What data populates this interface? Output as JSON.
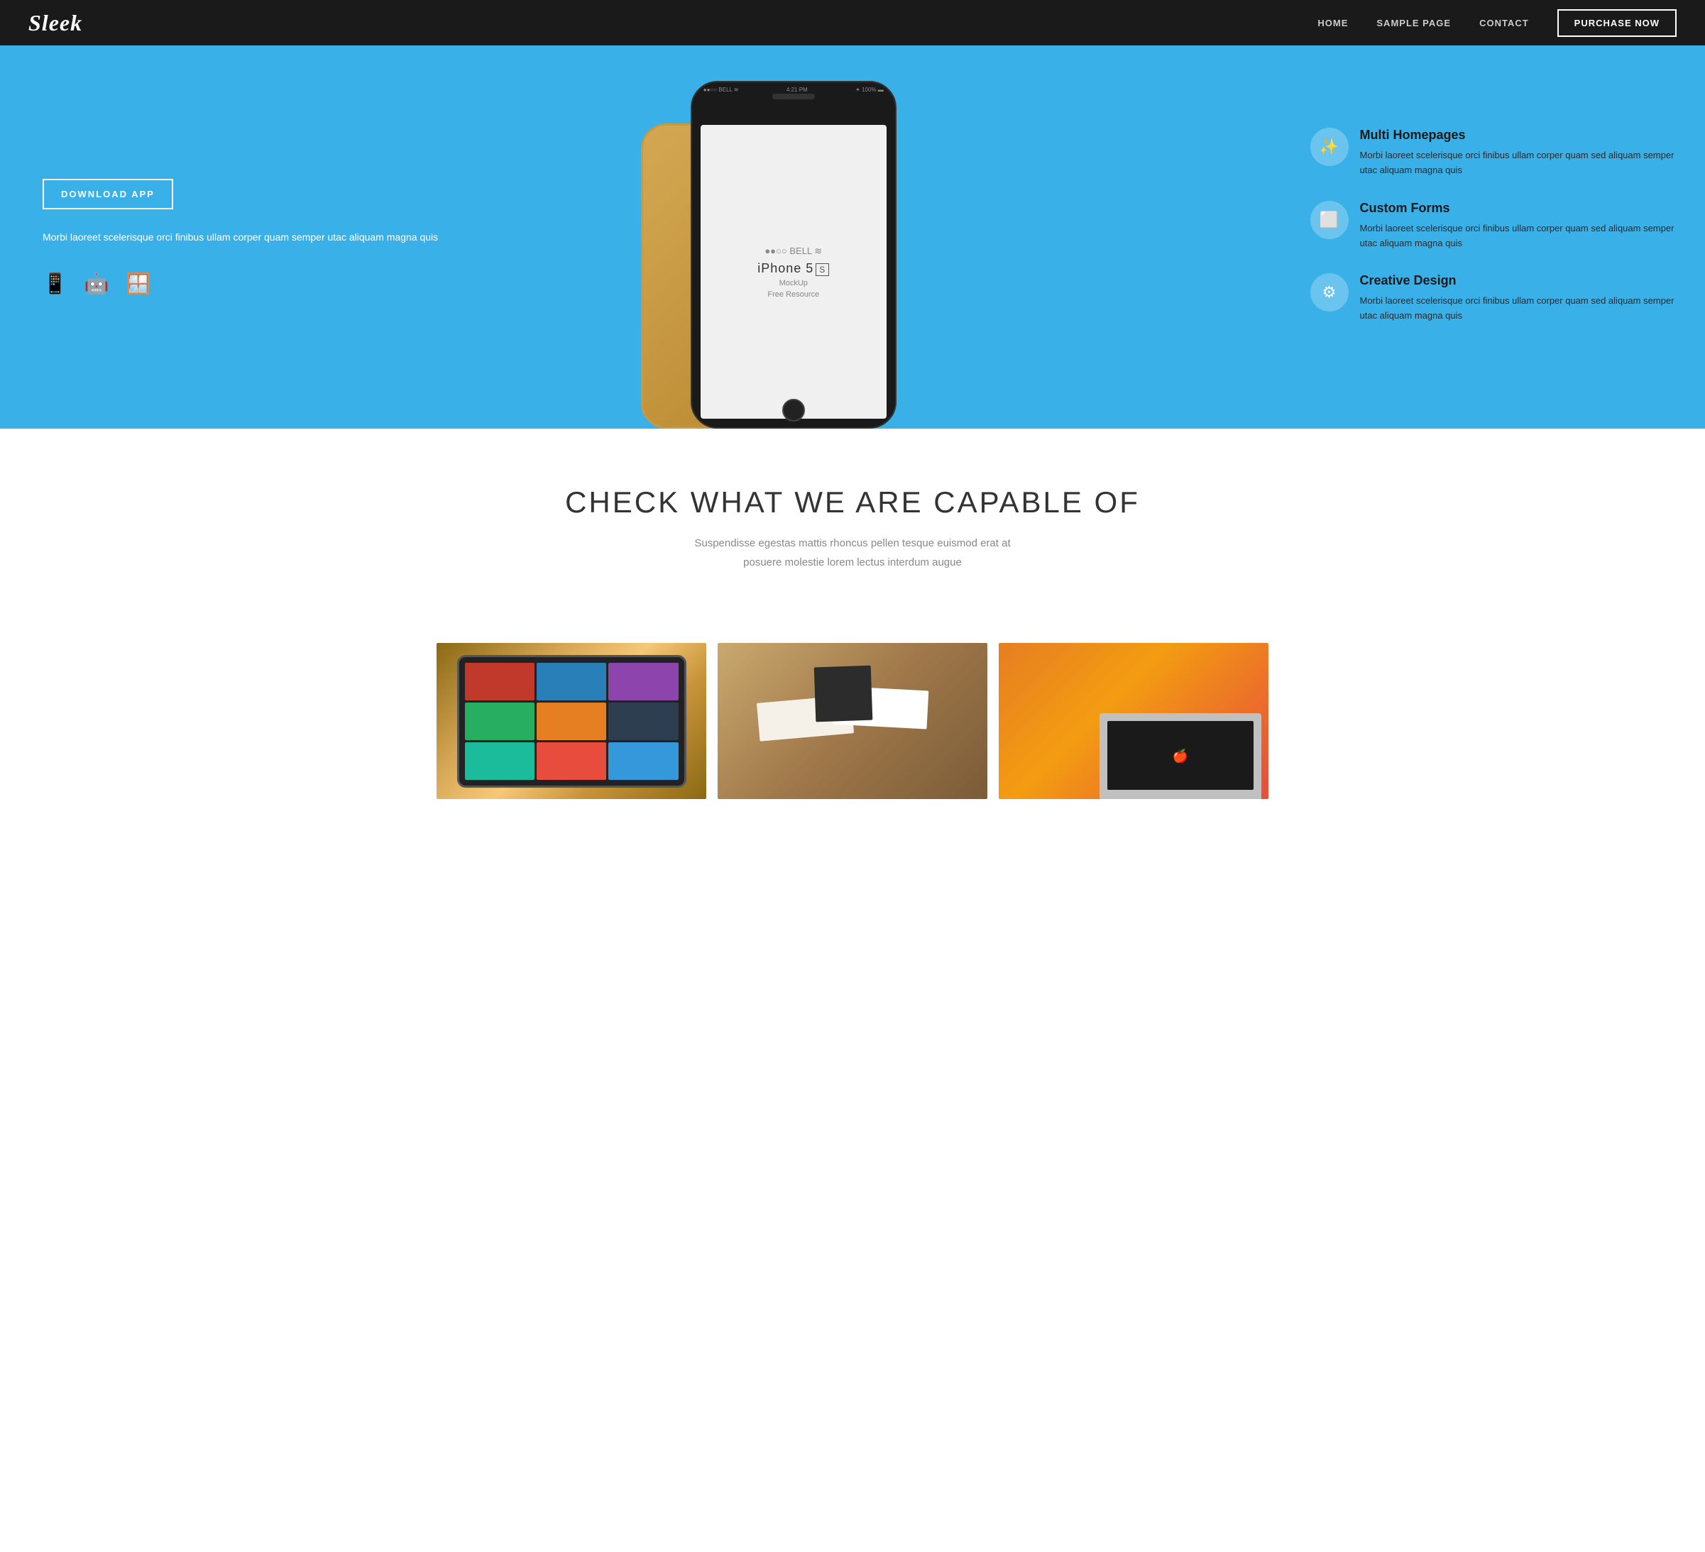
{
  "nav": {
    "logo": "Sleek",
    "links": [
      {
        "label": "HOME",
        "href": "#"
      },
      {
        "label": "SAMPLE PAGE",
        "href": "#"
      },
      {
        "label": "CONTACT",
        "href": "#"
      }
    ],
    "cta_label": "PURCHASE NOW"
  },
  "hero": {
    "download_btn": "DOWNLOAD APP",
    "description": "Morbi laoreet scelerisque orci finibus ullam corper quam semper utac aliquam magna quis",
    "platform_icons": [
      "📱",
      "🤖",
      "🪟"
    ],
    "features": [
      {
        "icon": "✨",
        "title": "Multi Homepages",
        "desc": "Morbi laoreet scelerisque orci finibus ullam corper quam sed aliquam semper utac aliquam magna quis"
      },
      {
        "icon": "⬜",
        "title": "Custom Forms",
        "desc": "Morbi laoreet scelerisque orci finibus ullam corper quam sed aliquam semper utac aliquam magna quis"
      },
      {
        "icon": "⚙",
        "title": "Creative Design",
        "desc": "Morbi laoreet scelerisque orci finibus ullam corper quam sed aliquam semper utac aliquam magna quis"
      }
    ],
    "phone": {
      "model": "iPhone 5",
      "sub1": "MockUp",
      "sub2": "Free Resource"
    }
  },
  "capabilities": {
    "heading": "CHECK WHAT WE ARE CAPABLE OF",
    "subtext_line1": "Suspendisse egestas mattis rhoncus pellen tesque euismod erat at",
    "subtext_line2": "posuere molestie lorem lectus interdum augue"
  },
  "gallery": [
    {
      "alt": "Tablet with app grid"
    },
    {
      "alt": "Stationery and branding items"
    },
    {
      "alt": "Person working on laptop"
    }
  ]
}
